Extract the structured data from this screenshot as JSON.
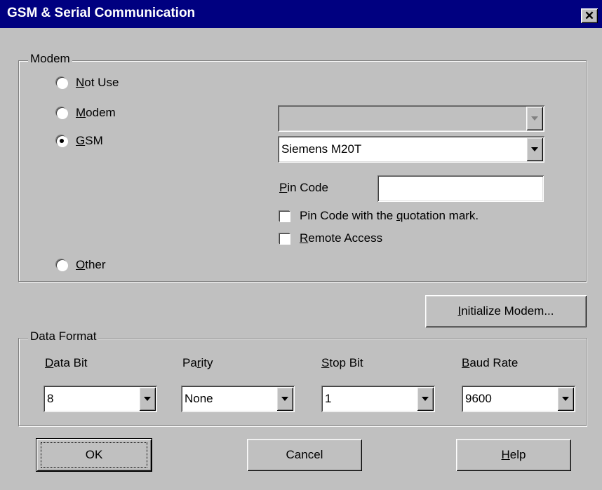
{
  "window": {
    "title": "GSM & Serial Communication",
    "close_glyph": "✕"
  },
  "modem_group": {
    "legend": "Modem",
    "options": [
      {
        "key": "N",
        "rest": "ot Use",
        "selected": false
      },
      {
        "key": "M",
        "rest": "odem",
        "selected": false
      },
      {
        "key": "G",
        "rest": "SM",
        "selected": true
      },
      {
        "key": "O",
        "rest": "ther",
        "selected": false
      }
    ],
    "modem_combo": {
      "value": ""
    },
    "gsm_combo": {
      "value": "Siemens M20T"
    },
    "pin_code": {
      "key": "P",
      "rest": "in Code",
      "value": ""
    },
    "pin_quote": {
      "before": "Pin Code with the ",
      "key": "q",
      "after": "uotation mark.",
      "checked": false
    },
    "remote_access": {
      "key": "R",
      "rest": "emote Access",
      "checked": false
    }
  },
  "initialize_button": {
    "key": "I",
    "rest": "nitialize Modem..."
  },
  "data_format": {
    "legend": "Data Format",
    "fields": [
      {
        "key": "D",
        "rest": "ata Bit",
        "value": "8"
      },
      {
        "pre": "Pa",
        "key": "r",
        "rest": "ity",
        "value": "None"
      },
      {
        "key": "S",
        "rest": "top Bit",
        "value": "1"
      },
      {
        "key": "B",
        "rest": "aud Rate",
        "value": "9600"
      }
    ]
  },
  "buttons": {
    "ok": "OK",
    "cancel": "Cancel",
    "help_key": "H",
    "help_rest": "elp"
  }
}
